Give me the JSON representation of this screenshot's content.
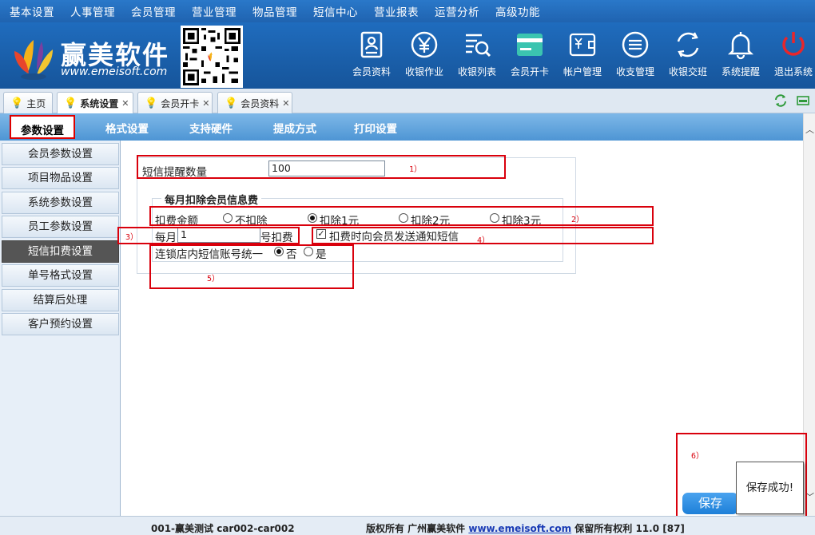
{
  "menu": [
    "基本设置",
    "人事管理",
    "会员管理",
    "营业管理",
    "物品管理",
    "短信中心",
    "营业报表",
    "运营分析",
    "高级功能"
  ],
  "brand": {
    "name": "赢美软件",
    "url": "www.emeisoft.com"
  },
  "toolbar": [
    {
      "label": "会员资料",
      "icon": "member-card-icon"
    },
    {
      "label": "收银作业",
      "icon": "yen-icon"
    },
    {
      "label": "收银列表",
      "icon": "list-search-icon"
    },
    {
      "label": "会员开卡",
      "icon": "card-icon"
    },
    {
      "label": "帐户管理",
      "icon": "wallet-icon"
    },
    {
      "label": "收支管理",
      "icon": "list-circle-icon"
    },
    {
      "label": "收银交班",
      "icon": "refresh-icon"
    },
    {
      "label": "系统提醒",
      "icon": "bell-icon"
    },
    {
      "label": "退出系统",
      "icon": "power-icon"
    }
  ],
  "tabs": [
    {
      "label": "主页",
      "closable": false
    },
    {
      "label": "系统设置",
      "closable": true,
      "active": true
    },
    {
      "label": "会员开卡",
      "closable": true
    },
    {
      "label": "会员资料",
      "closable": true
    }
  ],
  "subtabs": [
    "参数设置",
    "格式设置",
    "支持硬件",
    "提成方式",
    "打印设置"
  ],
  "sidebar": [
    "会员参数设置",
    "项目物品设置",
    "系统参数设置",
    "员工参数设置",
    "短信扣费设置",
    "单号格式设置",
    "结算后处理",
    "客户预约设置"
  ],
  "form": {
    "sms_remind_label": "短信提醒数量",
    "sms_remind_value": "100",
    "fee_legend": "每月扣除会员信息费",
    "fee_amount_label": "扣费金额",
    "fee_options": [
      "不扣除",
      "扣除1元",
      "扣除2元",
      "扣除3元"
    ],
    "fee_selected": "扣除1元",
    "monthly_prefix": "每月",
    "monthly_day": "1",
    "monthly_suffix": "号扣费",
    "notify_label": "扣费时向会员发送通知短信",
    "notify_checked": true,
    "chain_label": "连锁店内短信账号统一",
    "chain_options": [
      "否",
      "是"
    ],
    "chain_selected": "否"
  },
  "annotations": [
    "1）",
    "2）",
    "3）",
    "4）",
    "5）",
    "6）"
  ],
  "save_label": "保存",
  "toast": "保存成功!",
  "status": {
    "left": "001-赢美测试 car002-car002",
    "copyright": "版权所有 广州赢美软件",
    "link": "www.emeisoft.com",
    "rights": "保留所有权利 11.0 [87]"
  }
}
